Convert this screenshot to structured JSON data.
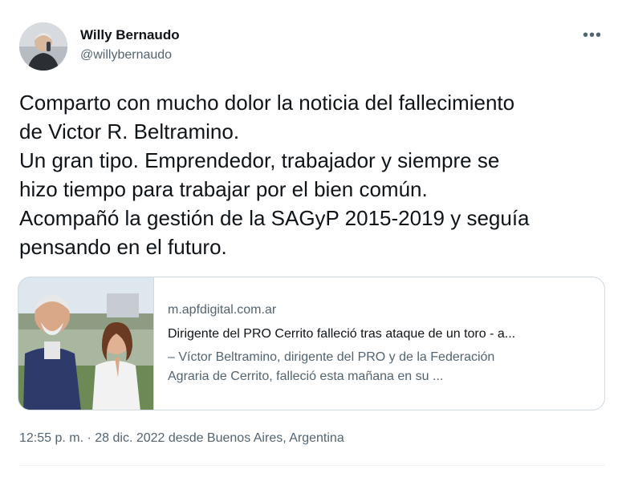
{
  "author": {
    "name": "Willy Bernaudo",
    "handle": "@willybernaudo"
  },
  "menu": {
    "icon": "more-horizontal-icon",
    "label": "•••"
  },
  "tweet": {
    "lines": [
      "Comparto con mucho dolor la noticia del fallecimiento",
      "de Victor R. Beltramino.",
      "Un gran tipo. Emprendedor, trabajador y siempre se",
      "hizo tiempo para trabajar por el bien común.",
      "Acompañó la gestión de la SAGyP 2015-2019 y seguía",
      "pensando en el futuro."
    ]
  },
  "card": {
    "domain": "m.apfdigital.com.ar",
    "title": "Dirigente del PRO Cerrito falleció tras ataque de un toro - a...",
    "description_lines": [
      "– Víctor Beltramino, dirigente del PRO y de la Federación",
      "Agraria de Cerrito, falleció esta mañana en su ..."
    ]
  },
  "meta": {
    "timestamp": "12:55 p. m. · 28 dic. 2022 desde Buenos Aires, Argentina"
  },
  "colors": {
    "text": "#0f1419",
    "secondary": "#536471",
    "border": "#cfd9de"
  }
}
